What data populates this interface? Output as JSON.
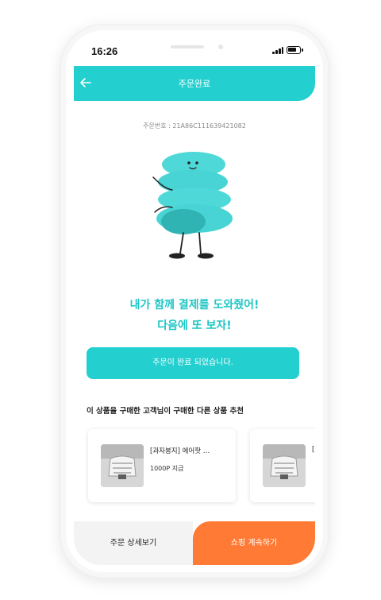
{
  "status": {
    "time": "16:26"
  },
  "header": {
    "title": "주문완료",
    "back_icon": "arrow-left-icon"
  },
  "order": {
    "number_label": "주문번호 : 21A86C111639421082"
  },
  "message": {
    "line1": "내가 함께 결제를 도와줬어!",
    "line2": "다음에 또 보자!"
  },
  "done_button": {
    "label": "주문이 완료 되었습니다."
  },
  "recommend": {
    "title": "이 상품을 구매한 고객님이 구매한 다른 상품 추천",
    "items": [
      {
        "name": "[과자봉지] 에어팟 …",
        "point": "1000P 지급"
      },
      {
        "name": "["
      }
    ]
  },
  "footer": {
    "detail_label": "주문 상세보기",
    "shop_label": "쇼핑 계속하기"
  },
  "colors": {
    "accent": "#23cfcf",
    "accent_text": "#1ec6c6",
    "orange": "#ff7a35"
  }
}
